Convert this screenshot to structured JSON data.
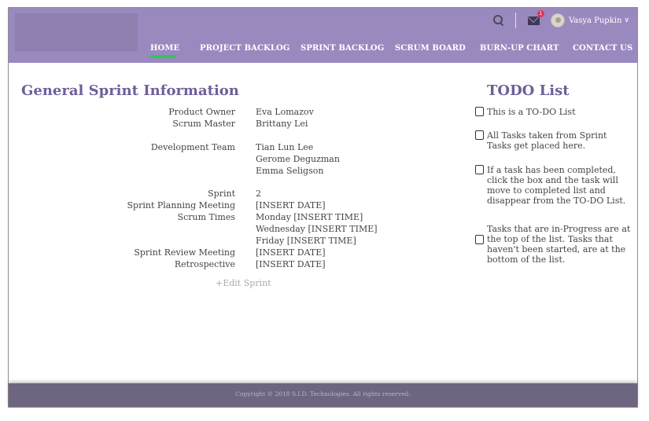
{
  "header": {
    "user_name": "Vasya Pupkin",
    "mail_badge_count": "1",
    "icons": [
      "search-icon",
      "mail-icon",
      "avatar",
      "chevron-down-icon"
    ],
    "nav": [
      {
        "label": "HOME",
        "active": true
      },
      {
        "label": "PROJECT BACKLOG"
      },
      {
        "label": "SPRINT BACKLOG"
      },
      {
        "label": "SCRUM BOARD"
      },
      {
        "label": "BURN-UP CHART"
      },
      {
        "label": "CONTACT US"
      }
    ]
  },
  "sprint_info": {
    "title": "General Sprint Information",
    "product_owner_label": "Product Owner",
    "product_owner": "Eva Lomazov",
    "scrum_master_label": "Scrum Master",
    "scrum_master": "Brittany Lei",
    "development_team_label": "Development Team",
    "development_team": [
      "Tian Lun Lee",
      "Gerome Deguzman",
      "Emma Seligson"
    ],
    "sprint_label": "Sprint",
    "sprint": "2",
    "planning_meeting_label": "Sprint Planning Meeting",
    "planning_meeting": "[INSERT DATE]",
    "scrum_times_label": "Scrum Times",
    "scrum_times": [
      "Monday [INSERT TIME]",
      "Wednesday [INSERT TIME]",
      "Friday [INSERT TIME]"
    ],
    "review_meeting_label": "Sprint Review Meeting",
    "review_meeting": "[INSERT DATE]",
    "retrospective_label": "Retrospective",
    "retrospective": "[INSERT DATE]",
    "edit_link": "+Edit Sprint"
  },
  "todo": {
    "title": "TODO List",
    "items": [
      "This is a TO-DO List",
      "All Tasks taken from Sprint Tasks get placed here.",
      "If a task has been completed, click the box and the task will move to completed list and disappear from the TO-DO List.",
      "Tasks that are in-Progress are at the top of the list. Tasks that haven't been started, are at the bottom of the list."
    ]
  },
  "footer": {
    "copyright": "Copyright © 2018 S.I.D. Technologies. All rights reserved."
  },
  "colors": {
    "header": "#9a89bf",
    "title": "#6e5f98",
    "active_nav": "#2ec75b",
    "footer": "#6e6680"
  }
}
